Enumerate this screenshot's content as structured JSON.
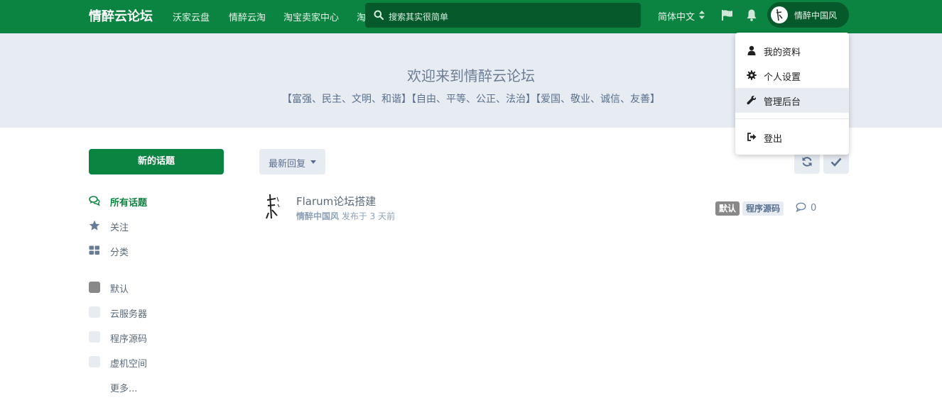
{
  "header": {
    "brand": "情醉云论坛",
    "nav": [
      "沃家云盘",
      "情醉云淘",
      "淘宝卖家中心",
      "淘"
    ],
    "search_placeholder": "搜索其实很简单",
    "language": "简体中文",
    "username": "情醉中国风"
  },
  "user_menu": {
    "items": [
      {
        "label": "我的资料",
        "icon": "user-icon"
      },
      {
        "label": "个人设置",
        "icon": "gear-icon"
      },
      {
        "label": "管理后台",
        "icon": "wrench-icon"
      },
      {
        "label": "登出",
        "icon": "sign-out-icon"
      }
    ]
  },
  "hero": {
    "title": "欢迎来到情醉云论坛",
    "subtitle": "【富强、民主、文明、和谐】【自由、平等、公正、法治】【爱国、敬业、诚信、友善】"
  },
  "sidebar": {
    "new_topic": "新的话题",
    "nav": [
      {
        "label": "所有话题",
        "icon": "comments-icon"
      },
      {
        "label": "关注",
        "icon": "star-icon"
      },
      {
        "label": "分类",
        "icon": "grid-icon"
      }
    ],
    "tags": [
      {
        "label": "默认",
        "color": "#888888"
      },
      {
        "label": "云服务器",
        "color": "#e7ebf2"
      },
      {
        "label": "程序源码",
        "color": "#e7ebf2"
      },
      {
        "label": "虚机空间",
        "color": "#e7ebf2"
      }
    ],
    "more": "更多..."
  },
  "toolbar": {
    "sort": "最新回复"
  },
  "discussions": [
    {
      "title": "Flarum论坛搭建",
      "author": "情醉中国风",
      "meta": " 发布于 3 天前",
      "tags": [
        {
          "label": "默认",
          "bg": "#888888",
          "fg": "#ffffff"
        },
        {
          "label": "程序源码",
          "bg": "#e7ebf2",
          "fg": "#58708e"
        }
      ],
      "replies": "0"
    }
  ],
  "colors": {
    "primary": "#0b8441",
    "primary_dark": "#06592b",
    "hero_bg": "#e7ebf2"
  }
}
